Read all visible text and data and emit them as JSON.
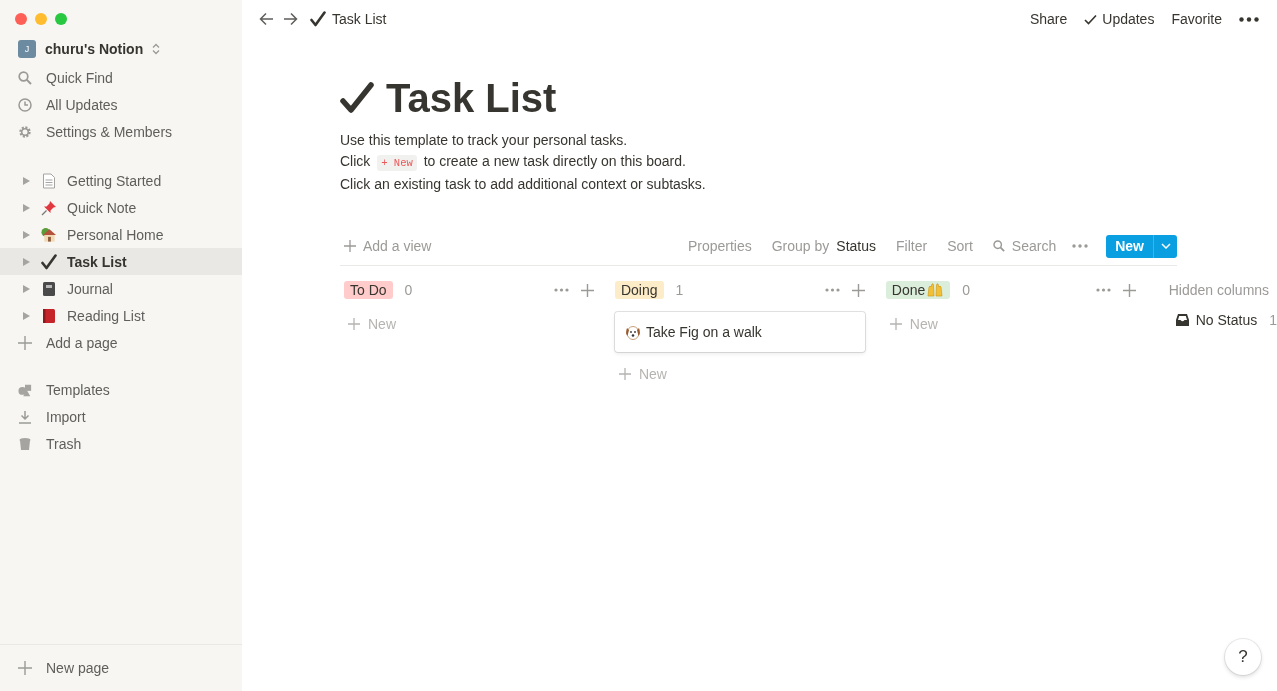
{
  "workspace": {
    "avatar": "J",
    "name": "churu's Notion"
  },
  "sidebar": {
    "actions": [
      "Quick Find",
      "All Updates",
      "Settings & Members"
    ],
    "pages": [
      {
        "label": "Getting Started",
        "selected": false
      },
      {
        "label": "Quick Note",
        "selected": false
      },
      {
        "label": "Personal Home",
        "selected": false
      },
      {
        "label": "Task List",
        "selected": true
      },
      {
        "label": "Journal",
        "selected": false
      },
      {
        "label": "Reading List",
        "selected": false
      }
    ],
    "add_page": "Add a page",
    "tools": [
      "Templates",
      "Import",
      "Trash"
    ],
    "new_page": "New page"
  },
  "topbar": {
    "breadcrumb": "Task List",
    "actions": [
      "Share",
      "Updates",
      "Favorite"
    ]
  },
  "page": {
    "title": "Task List",
    "description": [
      {
        "before": "Use this template to track your personal tasks."
      },
      {
        "before": "Click ",
        "code": "+ New",
        "after": " to create a new task directly on this board."
      },
      {
        "before": "Click an existing task to add additional context or subtasks."
      }
    ]
  },
  "board": {
    "add_view": "Add a view",
    "properties": "Properties",
    "group_by": "Group by",
    "group_field": "Status",
    "filter": "Filter",
    "sort": "Sort",
    "search": "Search",
    "new_button": "New",
    "columns": [
      {
        "name": "To Do",
        "count": "0",
        "color": "#ffcccb",
        "new": "New"
      },
      {
        "name": "Doing",
        "count": "1",
        "color": "#fdecc8",
        "cards": [
          "Take Fig on a walk"
        ],
        "new": "New"
      },
      {
        "name": "Done",
        "count": "0",
        "color": "#dbeddb",
        "new": "New"
      }
    ],
    "hidden_columns": {
      "label": "Hidden columns",
      "items": [
        {
          "name": "No Status",
          "count": "1"
        }
      ]
    }
  },
  "help": "?"
}
